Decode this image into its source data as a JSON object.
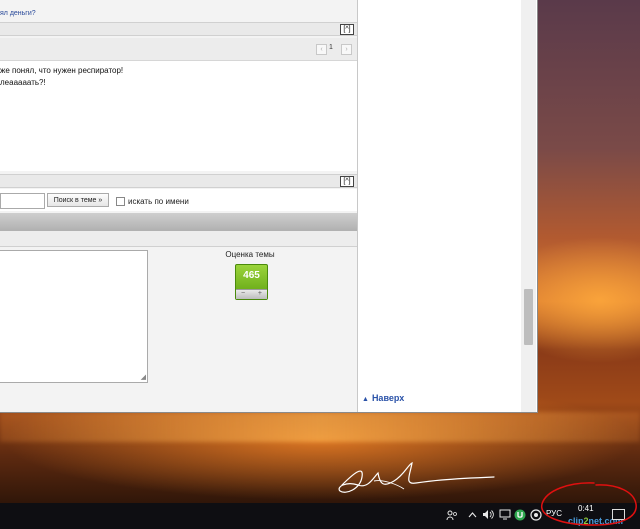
{
  "forum": {
    "top_link": "ял деньги?",
    "collapse_symbol": "[^]",
    "post_number": "1",
    "post_lines": [
      "же понял, что нужен респиратор!",
      "леааааать?!"
    ],
    "search": {
      "button_label": "Поиск в теме »",
      "checkbox_label": "искать по имени"
    },
    "rating": {
      "label": "Оценка темы",
      "value": "465",
      "minus": "−",
      "plus": "+"
    },
    "resize_grip": "◢"
  },
  "sidebar": {
    "back_to_top_label": "Наверх",
    "back_to_top_icon": "▲"
  },
  "taskbar": {
    "language": "РУС",
    "clock_time": "0:41",
    "clip2net_brand_a": "clip",
    "clip2net_brand_b": "2",
    "clip2net_brand_c": "net.com",
    "icons": [
      "people-icon",
      "chevron-up-icon",
      "volume-icon",
      "network-icon",
      "utorrent-icon",
      "app-circle-icon",
      "notification-icon"
    ]
  },
  "colors": {
    "accent_link": "#2a52a8",
    "rating_green": "#7ec225",
    "annotation_red": "#e01010"
  }
}
